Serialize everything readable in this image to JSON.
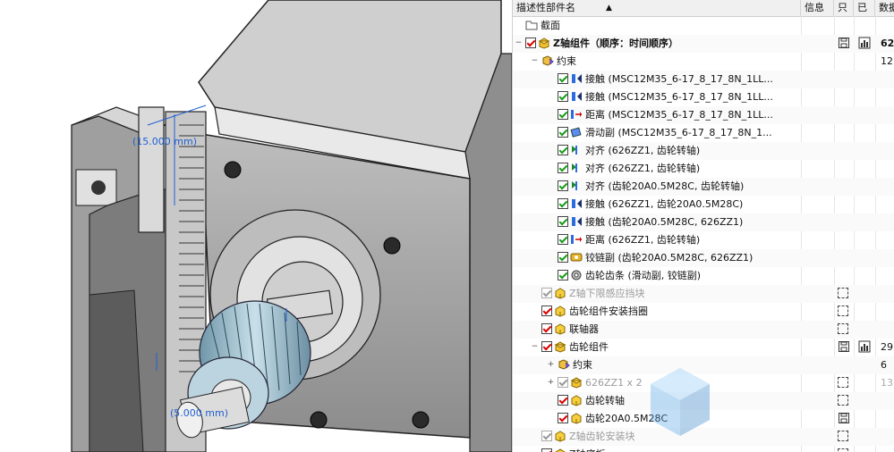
{
  "viewport": {
    "annotation_top": "(15.000 mm)",
    "annotation_bottom": "(5.000 mm)"
  },
  "tree": {
    "headers": {
      "name": "描述性部件名",
      "sort_icon": "sort-up-triangle",
      "info": "信息",
      "readonly": "只",
      "done": "已",
      "data": "数据"
    },
    "rows": [
      {
        "label": "截面",
        "icon": "folder-icon",
        "indent": 0,
        "checkbox": "none",
        "bold": false,
        "gray": false
      },
      {
        "label": "Z轴组件（顺序：时间顺序）",
        "icon": "assembly-icon",
        "indent": 0,
        "checkbox": "red",
        "bold": true,
        "gray": false,
        "expander": "−",
        "info_icons": [
          "save-icon",
          "bar-chart-icon"
        ],
        "num": "62"
      },
      {
        "label": "约束",
        "icon": "constraint-icon",
        "indent": 1,
        "checkbox": "none",
        "bold": false,
        "gray": false,
        "expander": "−",
        "num": "12"
      },
      {
        "label": "接触 (MSC12M35_6-17_8_17_8N_1LL...",
        "icon": "contact-icon",
        "indent": 2,
        "checkbox": "green"
      },
      {
        "label": "接触 (MSC12M35_6-17_8_17_8N_1LL...",
        "icon": "contact-icon",
        "indent": 2,
        "checkbox": "green"
      },
      {
        "label": "距离 (MSC12M35_6-17_8_17_8N_1LL...",
        "icon": "distance-icon",
        "indent": 2,
        "checkbox": "green"
      },
      {
        "label": "滑动副 (MSC12M35_6-17_8_17_8N_1...",
        "icon": "slide-icon",
        "indent": 2,
        "checkbox": "green"
      },
      {
        "label": "对齐 (626ZZ1, 齿轮转轴)",
        "icon": "align-icon",
        "indent": 2,
        "checkbox": "green"
      },
      {
        "label": "对齐 (626ZZ1, 齿轮转轴)",
        "icon": "align-icon",
        "indent": 2,
        "checkbox": "green"
      },
      {
        "label": "对齐 (齿轮20A0.5M28C, 齿轮转轴)",
        "icon": "align-icon",
        "indent": 2,
        "checkbox": "green"
      },
      {
        "label": "接触 (626ZZ1, 齿轮20A0.5M28C)",
        "icon": "contact-icon",
        "indent": 2,
        "checkbox": "green"
      },
      {
        "label": "接触 (齿轮20A0.5M28C, 626ZZ1)",
        "icon": "contact-icon",
        "indent": 2,
        "checkbox": "green"
      },
      {
        "label": "距离 (626ZZ1, 齿轮转轴)",
        "icon": "distance-icon",
        "indent": 2,
        "checkbox": "green"
      },
      {
        "label": "铰链副 (齿轮20A0.5M28C, 626ZZ1)",
        "icon": "hinge-icon",
        "indent": 2,
        "checkbox": "green"
      },
      {
        "label": "齿轮齿条 (滑动副, 铰链副)",
        "icon": "rack-pinion-icon",
        "indent": 2,
        "checkbox": "green"
      },
      {
        "label": "Z轴下限感应挡块",
        "icon": "part-icon",
        "indent": 1,
        "checkbox": "gray",
        "gray": true,
        "dash": true
      },
      {
        "label": "齿轮组件安装挡圈",
        "icon": "part-icon",
        "indent": 1,
        "checkbox": "red",
        "dash": true
      },
      {
        "label": "联轴器",
        "icon": "part-icon",
        "indent": 1,
        "checkbox": "red",
        "dash": true
      },
      {
        "label": "齿轮组件",
        "icon": "assembly-icon",
        "indent": 1,
        "checkbox": "red",
        "expander": "−",
        "info_icons": [
          "save-icon",
          "bar-chart-icon"
        ],
        "num": "29"
      },
      {
        "label": "约束",
        "icon": "constraint-icon",
        "indent": 2,
        "checkbox": "none",
        "expander": "+",
        "num": "6"
      },
      {
        "label": "626ZZ1 x 2",
        "icon": "assembly-icon",
        "indent": 2,
        "checkbox": "gray",
        "gray": true,
        "expander": "+",
        "dash": true,
        "num": "13",
        "num_gray": true
      },
      {
        "label": "齿轮转轴",
        "icon": "part-icon",
        "indent": 2,
        "checkbox": "red",
        "dash": true
      },
      {
        "label": "齿轮20A0.5M28C",
        "icon": "part-icon",
        "indent": 2,
        "checkbox": "red",
        "info_icons": [
          "save-icon"
        ]
      },
      {
        "label": "Z轴齿轮安装块",
        "icon": "part-icon",
        "indent": 1,
        "checkbox": "gray",
        "gray": true,
        "dash": true
      },
      {
        "label": "Z轴底板",
        "icon": "part-icon",
        "indent": 1,
        "checkbox": "red",
        "dash": true
      }
    ]
  }
}
